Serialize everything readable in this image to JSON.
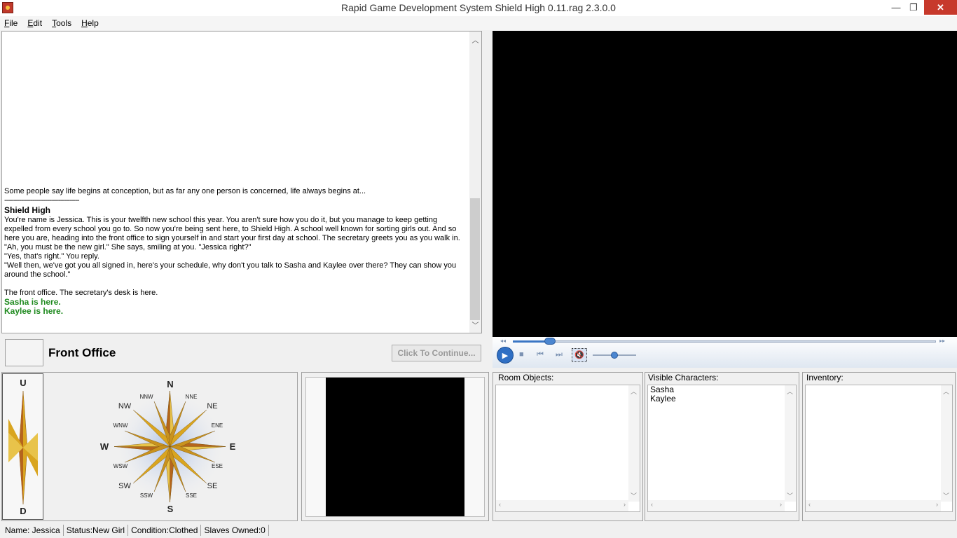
{
  "window": {
    "title": "Rapid Game Development System Shield High 0.11.rag 2.3.0.0",
    "min_glyph": "—",
    "max_glyph": "❐",
    "close_glyph": "✕"
  },
  "menu": {
    "items": [
      "File",
      "Edit",
      "Tools",
      "Help"
    ]
  },
  "story": {
    "intro": "Some people say life begins at conception, but as far any one person is concerned, life always begins at...",
    "separator": "----------------------------------------",
    "heading": "Shield High",
    "paragraph1": "You're name is Jessica. This is your twelfth new school this year. You aren't sure how you do it, but you manage to keep getting expelled from every school you go to. So now you're being sent here, to Shield High. A school well known for sorting girls out. And so here you are, heading into the front office to sign yourself in and start your first day at school. The secretary greets you as you walk in.",
    "line2": "\"Ah, you must be the new girl.\" She says, smiling at you. \"Jessica right?\"",
    "line3": "\"Yes, that's right.\" You reply.",
    "line4": "\"Well then, we've got you all signed in, here's your schedule, why don't you talk to Sasha and Kaylee over there? They can show you around the school.\"",
    "line5": "The front office. The secretary's desk is here.",
    "green1": "Sasha is here.",
    "green2": "Kaylee is here."
  },
  "room": {
    "name": "Front Office",
    "continue_label": "Click To Continue..."
  },
  "compass": {
    "up": "U",
    "down": "D",
    "N": "N",
    "NNE": "NNE",
    "NE": "NE",
    "ENE": "ENE",
    "E": "E",
    "ESE": "ESE",
    "SE": "SE",
    "SSE": "SSE",
    "S": "S",
    "SSW": "SSW",
    "SW": "SW",
    "WSW": "WSW",
    "W": "W",
    "WNW": "WNW",
    "NW": "NW",
    "NNW": "NNW"
  },
  "lists": {
    "room_objects": {
      "title": "Room Objects:",
      "items": []
    },
    "visible_characters": {
      "title": "Visible Characters:",
      "items": [
        "Sasha",
        "Kaylee"
      ]
    },
    "inventory": {
      "title": "Inventory:",
      "items": []
    }
  },
  "status": {
    "name": "Name: Jessica",
    "status": "Status:New Girl",
    "condition": "Condition:Clothed",
    "slaves": "Slaves Owned:0"
  },
  "colors": {
    "accent_green": "#1f8a1f",
    "media_blue": "#2f6fc4",
    "close_red": "#c7392b"
  }
}
